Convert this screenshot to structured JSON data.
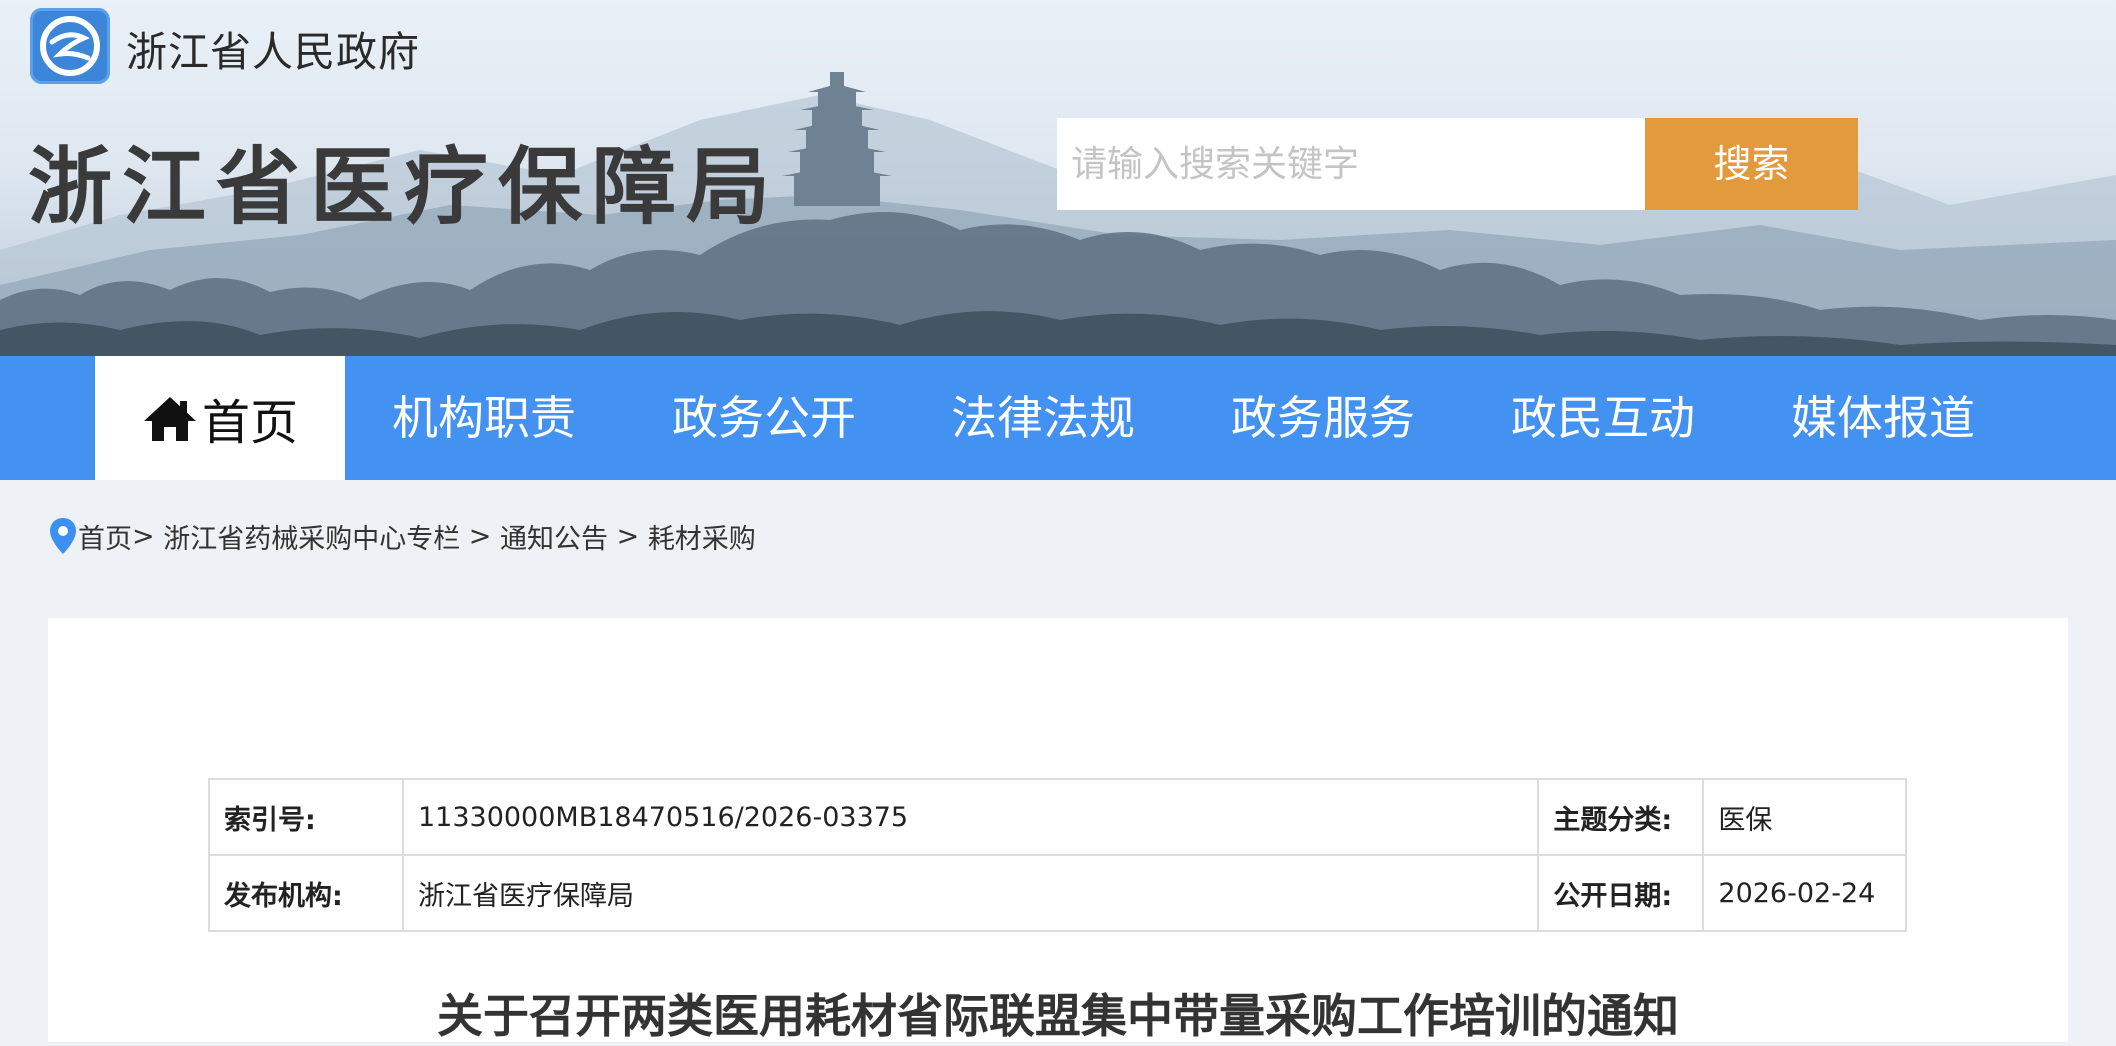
{
  "header": {
    "gov_name": "浙江省人民政府",
    "bureau_title": "浙江省医疗保障局",
    "search": {
      "placeholder": "请输入搜索关键字",
      "button_label": "搜索"
    }
  },
  "nav": {
    "home_label": "首页",
    "items": [
      "机构职责",
      "政务公开",
      "法律法规",
      "政务服务",
      "政民互动",
      "媒体报道"
    ]
  },
  "breadcrumb": {
    "items": [
      "首页",
      "浙江省药械采购中心专栏",
      "通知公告",
      "耗材采购"
    ]
  },
  "meta": {
    "index_label": "索引号:",
    "index_value": "11330000MB18470516/2026-03375",
    "topic_label": "主题分类:",
    "topic_value": "医保",
    "publisher_label": "发布机构:",
    "publisher_value": "浙江省医疗保障局",
    "date_label": "公开日期:",
    "date_value": "2026-02-24"
  },
  "article": {
    "title": "关于召开两类医用耗材省际联盟集中带量采购工作培训的通知"
  },
  "colors": {
    "nav_blue": "#4391f0",
    "search_button": "#e29a3c",
    "logo_blue": "#3b86d9"
  },
  "icons": [
    "government-logo-icon",
    "home-icon",
    "location-pin-icon"
  ]
}
